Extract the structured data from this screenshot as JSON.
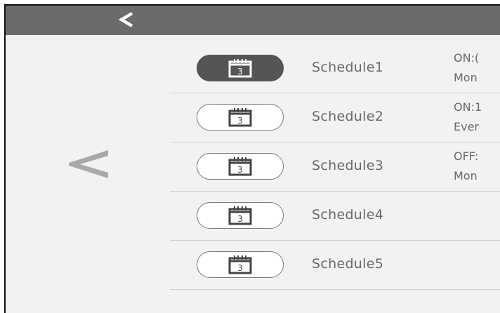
{
  "header": {
    "back_icon": "chevron-left-icon"
  },
  "nav": {
    "side_back_icon": "large-chevron-left-icon"
  },
  "schedules": [
    {
      "name": "Schedule1",
      "icon": "calendar-icon",
      "icon_number": "3",
      "active": true,
      "line1": "ON:(",
      "line2": "Mon"
    },
    {
      "name": "Schedule2",
      "icon": "calendar-icon",
      "icon_number": "3",
      "active": false,
      "line1": "ON:1",
      "line2": "Ever"
    },
    {
      "name": "Schedule3",
      "icon": "calendar-icon",
      "icon_number": "3",
      "active": false,
      "line1": "OFF:",
      "line2": "Mon"
    },
    {
      "name": "Schedule4",
      "icon": "calendar-icon",
      "icon_number": "3",
      "active": false,
      "line1": "",
      "line2": ""
    },
    {
      "name": "Schedule5",
      "icon": "calendar-icon",
      "icon_number": "3",
      "active": false,
      "line1": "",
      "line2": ""
    }
  ],
  "colors": {
    "topbar": "#6b6b6b",
    "background": "#f2f2f2",
    "active_badge": "#555555",
    "text": "#6a6a6a",
    "divider": "#cfcfcf"
  }
}
